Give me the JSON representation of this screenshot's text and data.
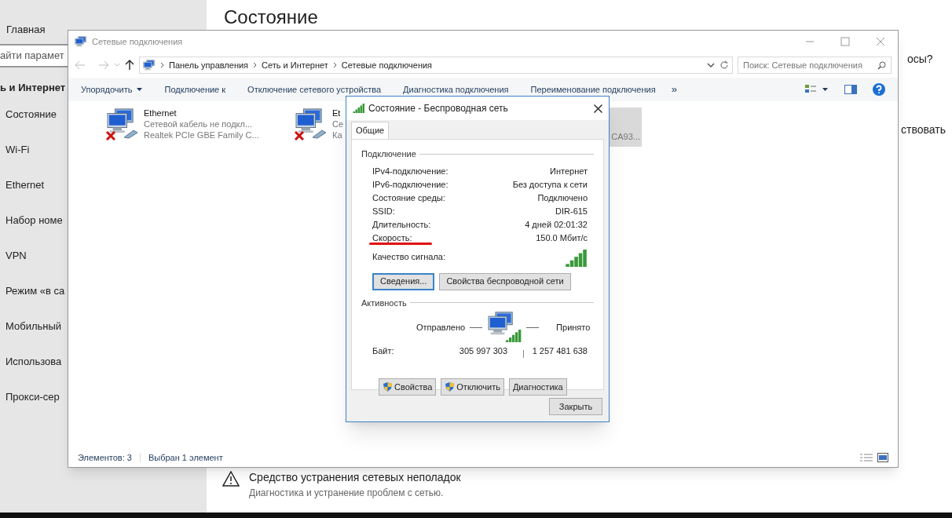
{
  "settings": {
    "home": "Главная",
    "search_placeholder": "айти парамет",
    "section": "ь и Интернет",
    "items": [
      {
        "label": "Состояние"
      },
      {
        "label": "Wi-Fi"
      },
      {
        "label": "Ethernet"
      },
      {
        "label": "Набор номе"
      },
      {
        "label": "VPN"
      },
      {
        "label": "Режим «в са"
      },
      {
        "label": "Мобильный"
      },
      {
        "label": "Использова"
      },
      {
        "label": "Прокси-сер"
      }
    ],
    "heading": "Состояние",
    "side_texts": [
      "осы?",
      "ствовать"
    ],
    "troubleshoot": {
      "title": "Средство устранения сетевых неполадок",
      "subtitle": "Диагностика и устранение проблем с сетью."
    }
  },
  "explorer": {
    "title": "Сетевые подключения",
    "breadcrumbs": [
      "Панель управления",
      "Сеть и Интернет",
      "Сетевые подключения"
    ],
    "search_placeholder": "Поиск: Сетевые подключения",
    "toolbar": [
      {
        "label": "Упорядочить",
        "dropdown": true
      },
      {
        "label": "Подключение к",
        "dropdown": false
      },
      {
        "label": "Отключение сетевого устройства",
        "dropdown": false
      },
      {
        "label": "Диагностика подключения",
        "dropdown": false
      },
      {
        "label": "Переименование подключения",
        "dropdown": false
      }
    ],
    "more": "»",
    "items": [
      {
        "name": "Ethernet",
        "line1": "Сетевой кабель не подкл...",
        "line2": "Realtek PCIe GBE Family C...",
        "selected": false,
        "disconnected": true
      },
      {
        "name": "Et",
        "line1": "Се",
        "line2": "Ка",
        "selected": false,
        "disconnected": true
      },
      {
        "line2": "CA93...",
        "selected": true
      }
    ],
    "status": [
      "Элементов: 3",
      "Выбран 1 элемент"
    ]
  },
  "dialog": {
    "title": "Состояние - Беспроводная сеть",
    "tabs": [
      {
        "label": "Общие",
        "selected": true
      }
    ],
    "connection": {
      "heading": "Подключение",
      "rows": [
        {
          "label": "IPv4-подключение:",
          "value": "Интернет",
          "underlined": false
        },
        {
          "label": "IPv6-подключение:",
          "value": "Без доступа к сети",
          "underlined": false
        },
        {
          "label": "Состояние среды:",
          "value": "Подключено",
          "underlined": false
        },
        {
          "label": "SSID:",
          "value": "DIR-615",
          "underlined": false
        },
        {
          "label": "Длительность:",
          "value": "4 дней 02:01:32",
          "underlined": false
        },
        {
          "label": "Скорость:",
          "value": "150.0 Мбит/с",
          "underlined": true
        }
      ],
      "signal_label": "Качество сигнала:",
      "buttons": [
        {
          "label": "Сведения...",
          "focused": true
        },
        {
          "label": "Свойства беспроводной сети",
          "focused": false
        }
      ]
    },
    "activity": {
      "heading": "Активность",
      "sent": "Отправлено",
      "received": "Принято",
      "bytes_label": "Байт:",
      "bytes_sent": "305 997 303",
      "bytes_received": "1 257 481 638"
    },
    "actions": [
      {
        "label": "Свойства",
        "shield": true
      },
      {
        "label": "Отключить",
        "shield": true
      },
      {
        "label": "Диагностика",
        "shield": false
      }
    ],
    "close": "Закрыть"
  }
}
